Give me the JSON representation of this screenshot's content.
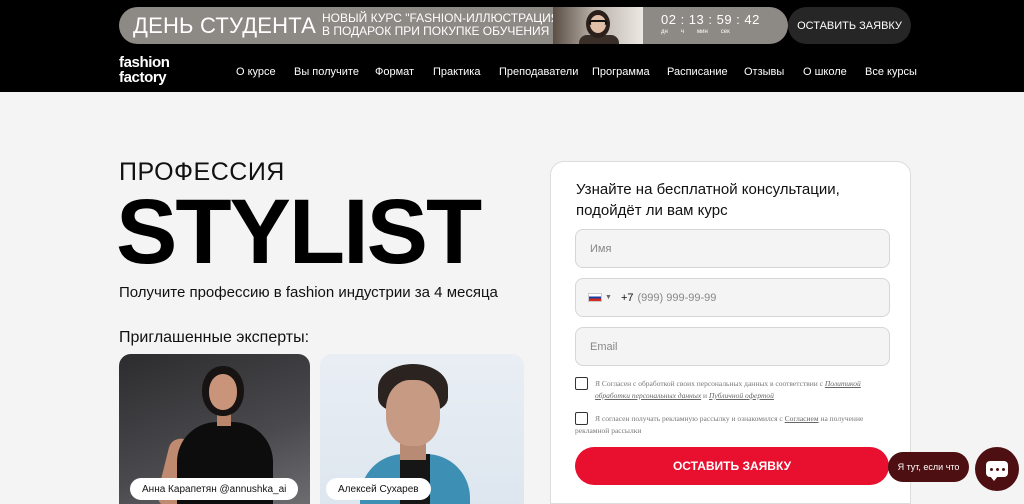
{
  "promo": {
    "title": "ДЕНЬ СТУДЕНТА",
    "offer_line1": "НОВЫЙ КУРС \"FASHION-ИЛЛЮСТРАЦИЯ\"",
    "offer_line2": "В ПОДАРОК ПРИ ПОКУПКЕ ОБУЧЕНИЯ",
    "timer": "02 : 13 : 59 : 42",
    "timer_units": [
      "дн",
      "ч",
      "мин",
      "сек"
    ],
    "cta": "ОСТАВИТЬ ЗАЯВКУ"
  },
  "logo": {
    "line1": "fashion",
    "line2": "factory"
  },
  "nav": [
    "О курсе",
    "Вы получите",
    "Формат",
    "Практика",
    "Преподаватели",
    "Программа",
    "Расписание",
    "Отзывы",
    "О школе",
    "Все курсы"
  ],
  "hero": {
    "kicker": "ПРОФЕССИЯ",
    "title": "STYLIST",
    "subtitle": "Получите профессию в fashion индустрии за 4 месяца",
    "experts_label": "Приглашенные эксперты:",
    "experts": [
      "Анна Карапетян @annushka_ai",
      "Алексей Сухарев"
    ]
  },
  "form": {
    "title": "Узнайте на бесплатной консультации, подойдёт ли вам курс",
    "name_placeholder": "Имя",
    "phone_code": "+7",
    "phone_placeholder": "(999) 999-99-99",
    "email_placeholder": "Email",
    "consent1_a": "Я Согласен с обработкой своих персональных данных в соответствии с ",
    "consent1_link1": "Политикой обработки персональных данных",
    "consent1_b": " и ",
    "consent1_link2": "Публичной офертой",
    "consent2_a": "Я согласен получать рекламную рассылку и ознакомился с ",
    "consent2_link": "Согласием",
    "consent2_b": " на получение рекламной рассылки",
    "submit": "ОСТАВИТЬ ЗАЯВКУ"
  },
  "chat": {
    "bubble": "Я тут, если что",
    "icon": "chat-icon"
  },
  "colors": {
    "accent": "#e8102e",
    "chat": "#4e0f12",
    "header": "#000000",
    "promo_bg": "#8d8984"
  }
}
